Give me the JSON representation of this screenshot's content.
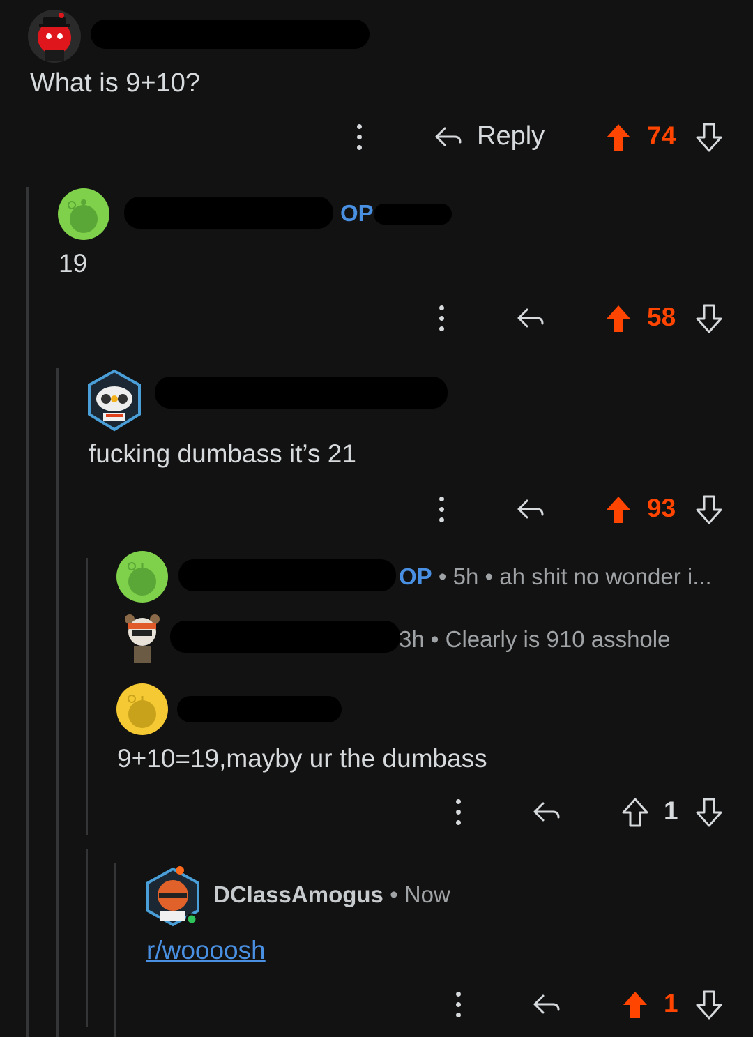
{
  "comments": [
    {
      "body": "What is 9+10?",
      "reply_label": "Reply",
      "score": "74",
      "voted": "up"
    },
    {
      "op_badge": "OP",
      "body": "19",
      "score": "58",
      "voted": "up"
    },
    {
      "body": "fucking dumbass it’s 21",
      "score": "93",
      "voted": "up"
    },
    {
      "op_badge": "OP",
      "separator": "•",
      "age": "5h",
      "preview": "ah shit no wonder i..."
    },
    {
      "age": "3h",
      "separator": "•",
      "preview": "Clearly is 910 asshole"
    },
    {
      "body": "9+10=19,mayby ur the dumbass",
      "score": "1",
      "voted": "none"
    },
    {
      "username": "DClassAmogus",
      "separator": "•",
      "age": "Now",
      "body_link": "r/woooosh",
      "score": "1",
      "voted": "up"
    }
  ],
  "colors": {
    "upvote": "#ff4500",
    "op": "#4a90e2",
    "background": "#121212",
    "text": "#d7dadc"
  }
}
